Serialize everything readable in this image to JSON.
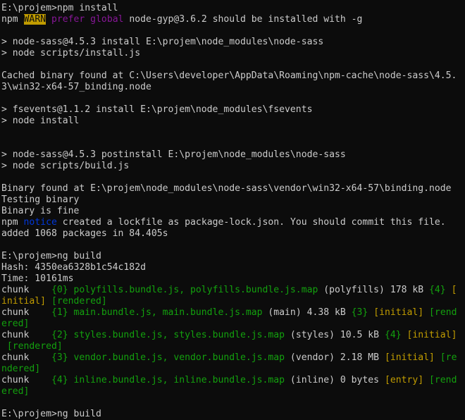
{
  "terminal": {
    "lines": [
      {
        "segments": [
          {
            "text": "E:\\projem>npm install",
            "style": "gray"
          }
        ]
      },
      {
        "segments": [
          {
            "text": "npm ",
            "style": "gray"
          },
          {
            "text": "WARN",
            "style": "yellow-bg"
          },
          {
            "text": " ",
            "style": "gray"
          },
          {
            "text": "prefer global",
            "style": "magenta"
          },
          {
            "text": " node-gyp@3.6.2 should be installed with -g",
            "style": "gray"
          }
        ]
      },
      {
        "segments": [
          {
            "text": "",
            "style": "gray"
          }
        ]
      },
      {
        "segments": [
          {
            "text": "> node-sass@4.5.3 install E:\\projem\\node_modules\\node-sass",
            "style": "gray"
          }
        ]
      },
      {
        "segments": [
          {
            "text": "> node scripts/install.js",
            "style": "gray"
          }
        ]
      },
      {
        "segments": [
          {
            "text": "",
            "style": "gray"
          }
        ]
      },
      {
        "segments": [
          {
            "text": "Cached binary found at C:\\Users\\developer\\AppData\\Roaming\\npm-cache\\node-sass\\4.5.",
            "style": "gray"
          }
        ]
      },
      {
        "segments": [
          {
            "text": "3\\win32-x64-57_binding.node",
            "style": "gray"
          }
        ]
      },
      {
        "segments": [
          {
            "text": "",
            "style": "gray"
          }
        ]
      },
      {
        "segments": [
          {
            "text": "> fsevents@1.1.2 install E:\\projem\\node_modules\\fsevents",
            "style": "gray"
          }
        ]
      },
      {
        "segments": [
          {
            "text": "> node install",
            "style": "gray"
          }
        ]
      },
      {
        "segments": [
          {
            "text": "",
            "style": "gray"
          }
        ]
      },
      {
        "segments": [
          {
            "text": "",
            "style": "gray"
          }
        ]
      },
      {
        "segments": [
          {
            "text": "> node-sass@4.5.3 postinstall E:\\projem\\node_modules\\node-sass",
            "style": "gray"
          }
        ]
      },
      {
        "segments": [
          {
            "text": "> node scripts/build.js",
            "style": "gray"
          }
        ]
      },
      {
        "segments": [
          {
            "text": "",
            "style": "gray"
          }
        ]
      },
      {
        "segments": [
          {
            "text": "Binary found at E:\\projem\\node_modules\\node-sass\\vendor\\win32-x64-57\\binding.node",
            "style": "gray"
          }
        ]
      },
      {
        "segments": [
          {
            "text": "Testing binary",
            "style": "gray"
          }
        ]
      },
      {
        "segments": [
          {
            "text": "Binary is fine",
            "style": "gray"
          }
        ]
      },
      {
        "segments": [
          {
            "text": "npm ",
            "style": "gray"
          },
          {
            "text": "notice",
            "style": "blue"
          },
          {
            "text": " created a lockfile as package-lock.json. You should commit this file.",
            "style": "gray"
          }
        ]
      },
      {
        "segments": [
          {
            "text": "added 1068 packages in 84.405s",
            "style": "gray"
          }
        ]
      },
      {
        "segments": [
          {
            "text": "",
            "style": "gray"
          }
        ]
      },
      {
        "segments": [
          {
            "text": "E:\\projem>ng build",
            "style": "gray"
          }
        ]
      },
      {
        "segments": [
          {
            "text": "Hash: 4350ea6328b1c54c182d",
            "style": "gray"
          }
        ]
      },
      {
        "segments": [
          {
            "text": "Time: 10161ms",
            "style": "gray"
          }
        ]
      },
      {
        "segments": [
          {
            "text": "chunk    ",
            "style": "gray"
          },
          {
            "text": "{0} polyfills.bundle.js, polyfills.bundle.js.map",
            "style": "green"
          },
          {
            "text": " (polyfills) 178 kB ",
            "style": "gray"
          },
          {
            "text": "{4}",
            "style": "green"
          },
          {
            "text": " ",
            "style": "gray"
          },
          {
            "text": "[",
            "style": "yellow"
          }
        ]
      },
      {
        "segments": [
          {
            "text": "initial]",
            "style": "yellow"
          },
          {
            "text": " ",
            "style": "gray"
          },
          {
            "text": "[rendered]",
            "style": "green"
          }
        ]
      },
      {
        "segments": [
          {
            "text": "chunk    ",
            "style": "gray"
          },
          {
            "text": "{1} main.bundle.js, main.bundle.js.map",
            "style": "green"
          },
          {
            "text": " (main) 4.38 kB ",
            "style": "gray"
          },
          {
            "text": "{3}",
            "style": "green"
          },
          {
            "text": " ",
            "style": "gray"
          },
          {
            "text": "[initial]",
            "style": "yellow"
          },
          {
            "text": " ",
            "style": "gray"
          },
          {
            "text": "[rend",
            "style": "green"
          }
        ]
      },
      {
        "segments": [
          {
            "text": "ered]",
            "style": "green"
          }
        ]
      },
      {
        "segments": [
          {
            "text": "chunk    ",
            "style": "gray"
          },
          {
            "text": "{2} styles.bundle.js, styles.bundle.js.map",
            "style": "green"
          },
          {
            "text": " (styles) 10.5 kB ",
            "style": "gray"
          },
          {
            "text": "{4}",
            "style": "green"
          },
          {
            "text": " ",
            "style": "gray"
          },
          {
            "text": "[initial]",
            "style": "yellow"
          }
        ]
      },
      {
        "segments": [
          {
            "text": " ",
            "style": "gray"
          },
          {
            "text": "[rendered]",
            "style": "green"
          }
        ]
      },
      {
        "segments": [
          {
            "text": "chunk    ",
            "style": "gray"
          },
          {
            "text": "{3} vendor.bundle.js, vendor.bundle.js.map",
            "style": "green"
          },
          {
            "text": " (vendor) 2.18 MB ",
            "style": "gray"
          },
          {
            "text": "[initial]",
            "style": "yellow"
          },
          {
            "text": " ",
            "style": "gray"
          },
          {
            "text": "[re",
            "style": "green"
          }
        ]
      },
      {
        "segments": [
          {
            "text": "ndered]",
            "style": "green"
          }
        ]
      },
      {
        "segments": [
          {
            "text": "chunk    ",
            "style": "gray"
          },
          {
            "text": "{4} inline.bundle.js, inline.bundle.js.map",
            "style": "green"
          },
          {
            "text": " (inline) 0 bytes ",
            "style": "gray"
          },
          {
            "text": "[entry]",
            "style": "yellow"
          },
          {
            "text": " ",
            "style": "gray"
          },
          {
            "text": "[rend",
            "style": "green"
          }
        ]
      },
      {
        "segments": [
          {
            "text": "ered]",
            "style": "green"
          }
        ]
      },
      {
        "segments": [
          {
            "text": "",
            "style": "gray"
          }
        ]
      },
      {
        "segments": [
          {
            "text": "E:\\projem>ng build",
            "style": "gray"
          }
        ]
      }
    ]
  },
  "colors": {
    "background": "#0c0c0c",
    "default_text": "#cccccc",
    "warn_bg": "#c19c00",
    "magenta": "#881798",
    "blue": "#0037da",
    "yellow": "#c19c00",
    "green": "#13a10e"
  }
}
